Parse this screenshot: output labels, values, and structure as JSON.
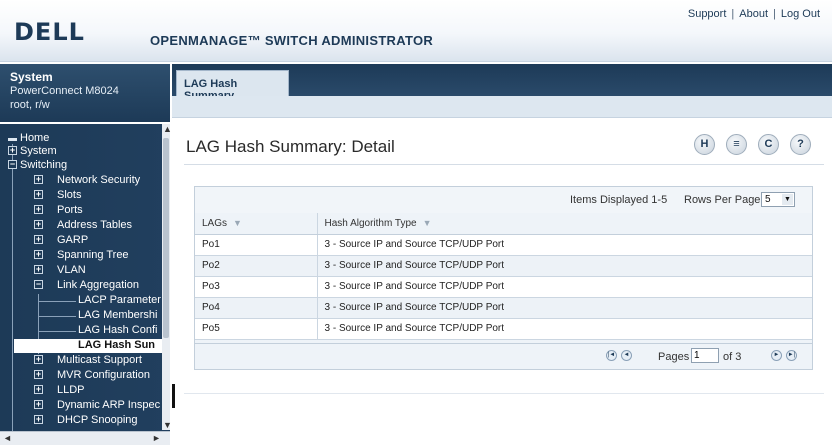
{
  "header": {
    "logo_text": "DELL",
    "app_title": "OPENMANAGE™ SWITCH ADMINISTRATOR",
    "links": [
      "Support",
      "About",
      "Log Out"
    ]
  },
  "system": {
    "title": "System",
    "model": "PowerConnect M8024",
    "user": "root, r/w"
  },
  "nav": {
    "items": [
      {
        "label": "Home"
      },
      {
        "label": "System"
      },
      {
        "label": "Switching"
      },
      {
        "label": "Network Security"
      },
      {
        "label": "Slots"
      },
      {
        "label": "Ports"
      },
      {
        "label": "Address Tables"
      },
      {
        "label": "GARP"
      },
      {
        "label": "Spanning Tree"
      },
      {
        "label": "VLAN"
      },
      {
        "label": "Link Aggregation"
      },
      {
        "label": "LACP Parameter"
      },
      {
        "label": "LAG Membershi"
      },
      {
        "label": "LAG Hash Confi"
      },
      {
        "label": "LAG Hash Sun"
      },
      {
        "label": "Multicast Support"
      },
      {
        "label": "MVR Configuration"
      },
      {
        "label": "LLDP"
      },
      {
        "label": "Dynamic ARP Inspec"
      },
      {
        "label": "DHCP Snooping"
      }
    ]
  },
  "tab": {
    "label": "LAG Hash Summary"
  },
  "page": {
    "title": "LAG Hash Summary: Detail"
  },
  "actions": {
    "save": "H",
    "print": "≡",
    "refresh": "C",
    "help": "?"
  },
  "table": {
    "items_displayed": "Items Displayed 1-5",
    "rows_per_page_label": "Rows Per Page",
    "rows_per_page_value": "5",
    "columns": [
      "LAGs",
      "Hash Algorithm Type"
    ],
    "rows": [
      {
        "lag": "Po1",
        "hash": "3 - Source IP and Source TCP/UDP Port"
      },
      {
        "lag": "Po2",
        "hash": "3 - Source IP and Source TCP/UDP Port"
      },
      {
        "lag": "Po3",
        "hash": "3 - Source IP and Source TCP/UDP Port"
      },
      {
        "lag": "Po4",
        "hash": "3 - Source IP and Source TCP/UDP Port"
      },
      {
        "lag": "Po5",
        "hash": "3 - Source IP and Source TCP/UDP Port"
      }
    ]
  },
  "pager": {
    "pages_label": "Pages",
    "page_value": "1",
    "of_label": "of 3"
  }
}
